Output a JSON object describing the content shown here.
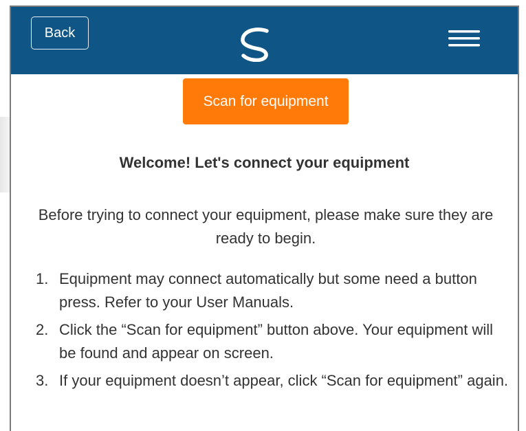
{
  "header": {
    "back_label": "Back",
    "logo_icon": "brand-swirl-icon",
    "menu_icon": "hamburger-menu-icon",
    "background_color": "#0f5585"
  },
  "main": {
    "scan_button_label": "Scan for equipment",
    "scan_button_color": "#ff7a08",
    "welcome_title": "Welcome! Let's connect your equipment",
    "intro_text": "Before trying to connect your equipment, please make sure they are ready to begin.",
    "steps": [
      {
        "number": "1.",
        "text": "Equipment may connect automatically but some need a button press. Refer to your User Manuals."
      },
      {
        "number": "2.",
        "text": "Click the “Scan for equipment” button above. Your equipment will be found and appear on screen."
      },
      {
        "number": "3.",
        "text": "If your equipment doesn’t appear, click “Scan for equipment” again."
      }
    ]
  }
}
